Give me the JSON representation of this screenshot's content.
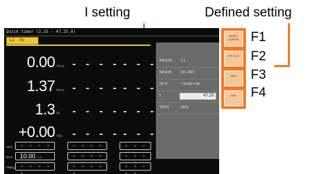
{
  "callouts": {
    "i_setting": "I setting",
    "defined_setting": "Defined setting"
  },
  "fkey_labels": [
    "F1",
    "F2",
    "F3",
    "F4"
  ],
  "screen": {
    "title": "Quick timer (2.25 - 47.25 A)",
    "tab_label": "L1",
    "tab_badge": "RE",
    "readings": [
      {
        "value": "0.00",
        "unit": "Vrms"
      },
      {
        "value": "1.37",
        "unit": "Arms"
      },
      {
        "value": "1.3",
        "unit": "W"
      },
      {
        "value": "+0.00",
        "unit": "Vdc"
      }
    ],
    "dashes": "- - - -"
  },
  "params": [
    {
      "label": "PHASE",
      "value": "L1"
    },
    {
      "label": "MODE",
      "value": "DC-INT"
    },
    {
      "label": "DCV",
      "value": "+10.00 Vdc"
    },
    {
      "label": "I",
      "value": "47.25"
    },
    {
      "label": "TEST",
      "value": "SEQ"
    }
  ],
  "softkeys": [
    "RESET CONFIG",
    "IPK CLR",
    "MAX",
    "MIN"
  ],
  "bottom": {
    "rows": [
      {
        "label": "ACV",
        "cells": [
          "- - - - -",
          "- - - - -",
          "- - - - -"
        ]
      },
      {
        "label": "DCV",
        "cells": [
          "10.00",
          "- - - - -",
          "- - - - -"
        ],
        "unit": "Vdc"
      },
      {
        "label": "FREQ",
        "cells": [
          "- - - - -",
          "- - - - -",
          "- - - - -"
        ]
      }
    ]
  },
  "colors": {
    "accent": "#f47a20",
    "tab": "#e8c840",
    "screen_bg": "#0b0b0b",
    "param_bg": "#6a6a6a"
  }
}
